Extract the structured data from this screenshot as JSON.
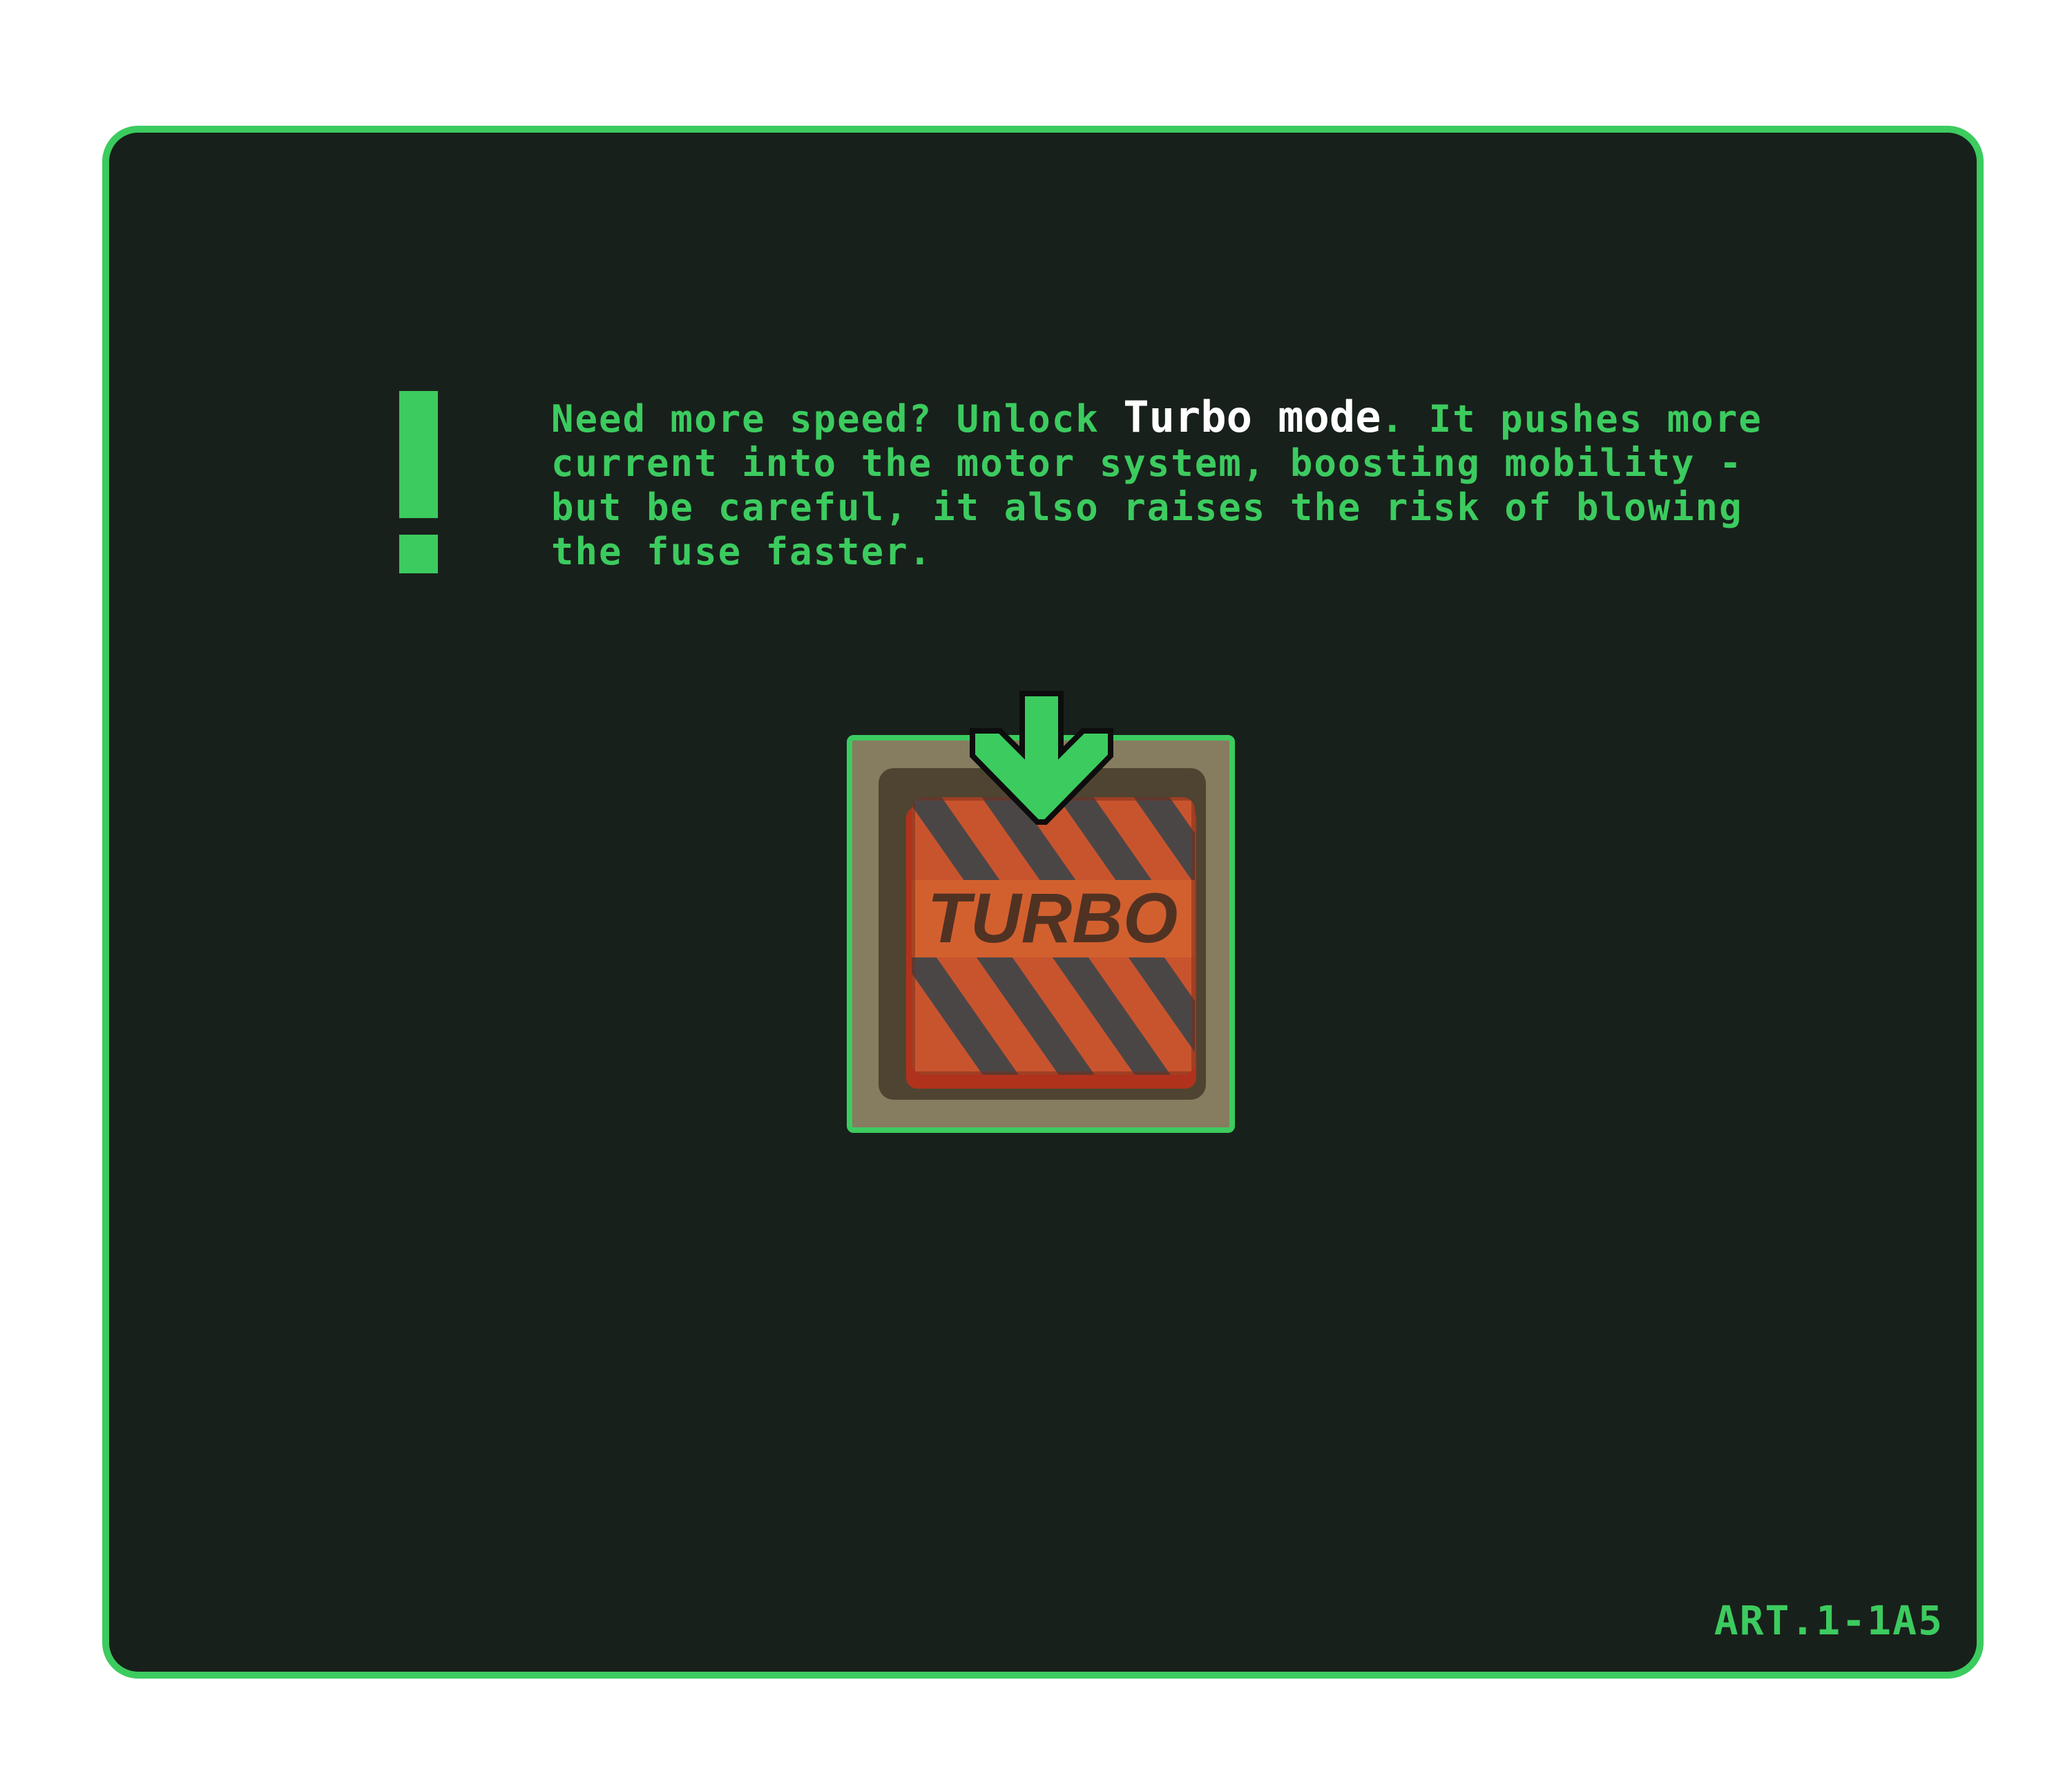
{
  "colors": {
    "accent_green": "#3ccb5f",
    "panel_bg": "#18201b",
    "highlight_text": "#ffffff",
    "turbo_orange": "#d4562e",
    "turbo_dark_stripe": "#4a4a4a"
  },
  "message": {
    "line1_prefix": "Need more speed? Unlock ",
    "highlight": "Turbo mode",
    "line1_suffix": ". It pushes more",
    "line2": "current into the motor system, boosting mobility -",
    "line3": "but be careful, it also raises the risk of blowing",
    "line4": "the fuse faster."
  },
  "turbo_button": {
    "label": "TURBO",
    "icon": "turbo-button-icon"
  },
  "indicator": {
    "icon": "arrow-down-icon"
  },
  "warning": {
    "icon": "exclamation-icon"
  },
  "footer": {
    "code": "ART.1-1A5"
  }
}
